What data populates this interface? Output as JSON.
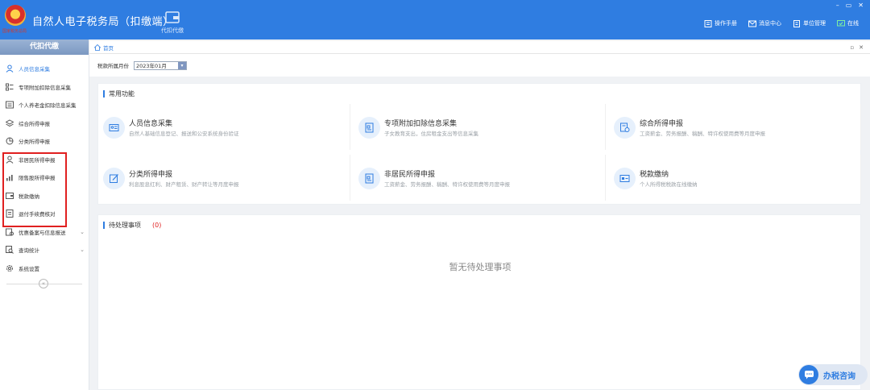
{
  "header": {
    "emblem_text": "国家税务总局",
    "title": "自然人电子税务局（扣缴端）",
    "nav_tab": "代扣代缴",
    "links": [
      {
        "label": "操作手册",
        "icon": "manual-icon"
      },
      {
        "label": "消息中心",
        "icon": "mail-icon"
      },
      {
        "label": "单位管理",
        "icon": "building-icon"
      },
      {
        "label": "在线",
        "icon": "online-icon"
      }
    ],
    "window_controls": [
      "–",
      "▭",
      "✕"
    ]
  },
  "sidebar": {
    "heading": "代扣代缴",
    "collapse_label": "«",
    "items": [
      {
        "label": "人员信息采集",
        "icon": "person-icon",
        "active": true
      },
      {
        "label": "专项附加扣除信息采集",
        "icon": "list-icon"
      },
      {
        "label": "个人养老金扣除信息采集",
        "icon": "card-icon"
      },
      {
        "label": "综合所得申报",
        "icon": "layers-icon"
      },
      {
        "label": "分类所得申报",
        "icon": "pie-icon"
      },
      {
        "label": "非居民所得申报",
        "icon": "person-icon"
      },
      {
        "label": "限售股所得申报",
        "icon": "bar-icon"
      },
      {
        "label": "税款缴纳",
        "icon": "wallet-icon"
      },
      {
        "label": "退付手续费核对",
        "icon": "doc-icon"
      },
      {
        "label": "优惠备案与信息报送",
        "icon": "report-icon",
        "chevron": "⌄"
      },
      {
        "label": "查询统计",
        "icon": "search-icon",
        "chevron": "⌄"
      },
      {
        "label": "系统设置",
        "icon": "gear-icon"
      }
    ]
  },
  "breadcrumb": {
    "home": "首页",
    "controls": [
      "▫",
      "✕"
    ]
  },
  "filter": {
    "label": "税款所属月份",
    "month": "2023年01月",
    "dropdown": "▾"
  },
  "common_functions": {
    "title": "常用功能",
    "cards": [
      {
        "title": "人员信息采集",
        "desc": "自然人基础信息登记、报送和公安系统身份验证",
        "icon": "id-card-icon"
      },
      {
        "title": "专项附加扣除信息采集",
        "desc": "子女教育支出，住房租金支出等信息采集",
        "icon": "form-icon"
      },
      {
        "title": "综合所得申报",
        "desc": "工资薪金、劳务报酬、稿酬、特许权使用费等月度申报",
        "icon": "report-doc-icon"
      },
      {
        "title": "分类所得申报",
        "desc": "利息股息红利、财产租赁、财产转让等月度申报",
        "icon": "edit-icon"
      },
      {
        "title": "非居民所得申报",
        "desc": "工资薪金、劳务报酬、稿酬、特许权使用费等月度申报",
        "icon": "form-icon"
      },
      {
        "title": "税款缴纳",
        "desc": "个人所得税税款在线缴纳",
        "icon": "payment-icon"
      }
    ]
  },
  "pending": {
    "title": "待处理事项",
    "count": "(0)",
    "empty": "暂无待处理事项"
  },
  "consult": {
    "label": "办税咨询",
    "icon": "chat-icon"
  },
  "colors": {
    "primary": "#2f7de1",
    "highlight": "#e02020"
  }
}
